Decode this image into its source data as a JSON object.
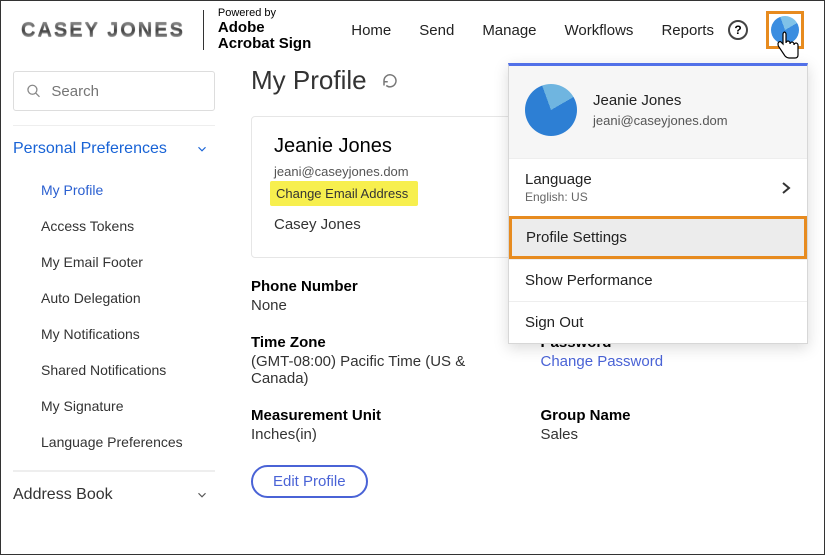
{
  "header": {
    "brand": "CASEY JONES",
    "powered_label": "Powered by",
    "powered_brand1": "Adobe",
    "powered_brand2": "Acrobat Sign",
    "nav": [
      "Home",
      "Send",
      "Manage",
      "Workflows",
      "Reports"
    ]
  },
  "sidebar": {
    "search_placeholder": "Search",
    "section_title": "Personal Preferences",
    "items": [
      "My Profile",
      "Access Tokens",
      "My Email Footer",
      "Auto Delegation",
      "My Notifications",
      "Shared Notifications",
      "My Signature",
      "Language Preferences"
    ],
    "address_book": "Address Book"
  },
  "page": {
    "title": "My Profile"
  },
  "profile": {
    "name": "Jeanie Jones",
    "email": "jeani@caseyjones.dom",
    "change_email": "Change Email Address",
    "company": "Casey Jones",
    "phone_label": "Phone Number",
    "phone_value": "None",
    "tz_label": "Time Zone",
    "tz_value": "(GMT-08:00) Pacific Time (US & Canada)",
    "unit_label": "Measurement Unit",
    "unit_value": "Inches(in)",
    "password_label": "Password",
    "password_value": "Change Password",
    "group_label": "Group Name",
    "group_value": "Sales",
    "edit_btn": "Edit Profile"
  },
  "dropdown": {
    "user_name": "Jeanie Jones",
    "user_email": "jeani@caseyjones.dom",
    "language_label": "Language",
    "language_value": "English: US",
    "profile_settings": "Profile Settings",
    "show_performance": "Show Performance",
    "sign_out": "Sign Out"
  }
}
